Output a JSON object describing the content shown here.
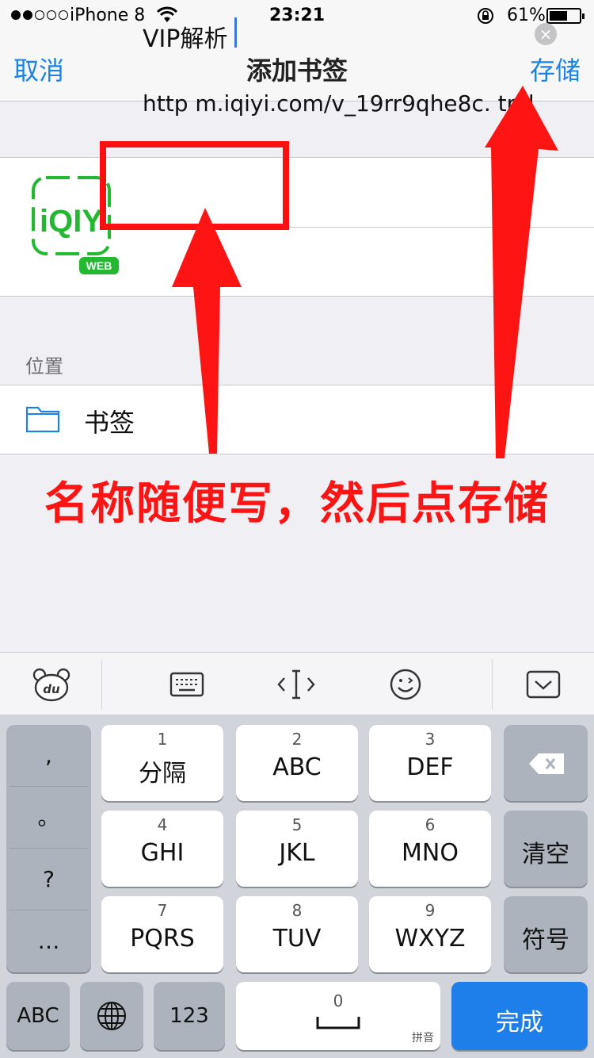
{
  "status_bar": {
    "carrier": "iPhone 8",
    "time": "23:21",
    "battery_percent": "61%",
    "battery_level": 0.61,
    "signal_bars_filled": 2,
    "signal_bars_total": 5
  },
  "nav": {
    "cancel_label": "取消",
    "title": "添加书签",
    "save_label": "存储"
  },
  "bookmark": {
    "name_value": "VIP解析",
    "url_value": "http  m.iqiyi.com/v_19rr9qhe8c.  tml",
    "logo_text": "iQIYI",
    "logo_badge": "WEB"
  },
  "location": {
    "header": "位置",
    "folder_label": "书签"
  },
  "annotation": {
    "text": "名称随便写，然后点存储"
  },
  "keyboard": {
    "punct": [
      ",",
      "。",
      "?",
      "…"
    ],
    "keys": [
      {
        "num": "1",
        "label": "分隔"
      },
      {
        "num": "2",
        "label": "ABC"
      },
      {
        "num": "3",
        "label": "DEF"
      },
      {
        "num": "4",
        "label": "GHI"
      },
      {
        "num": "5",
        "label": "JKL"
      },
      {
        "num": "6",
        "label": "MNO"
      },
      {
        "num": "7",
        "label": "PQRS"
      },
      {
        "num": "8",
        "label": "TUV"
      },
      {
        "num": "9",
        "label": "WXYZ"
      }
    ],
    "clear_label": "清空",
    "symbol_label": "符号",
    "abc_label": "ABC",
    "num_label": "123",
    "space_num": "0",
    "space_hint": "拼音",
    "done_label": "完成"
  },
  "colors": {
    "ios_blue": "#1a83e8",
    "annotation_red": "#ff1414",
    "iqiyi_green": "#22b930",
    "done_blue": "#1f7fea"
  }
}
